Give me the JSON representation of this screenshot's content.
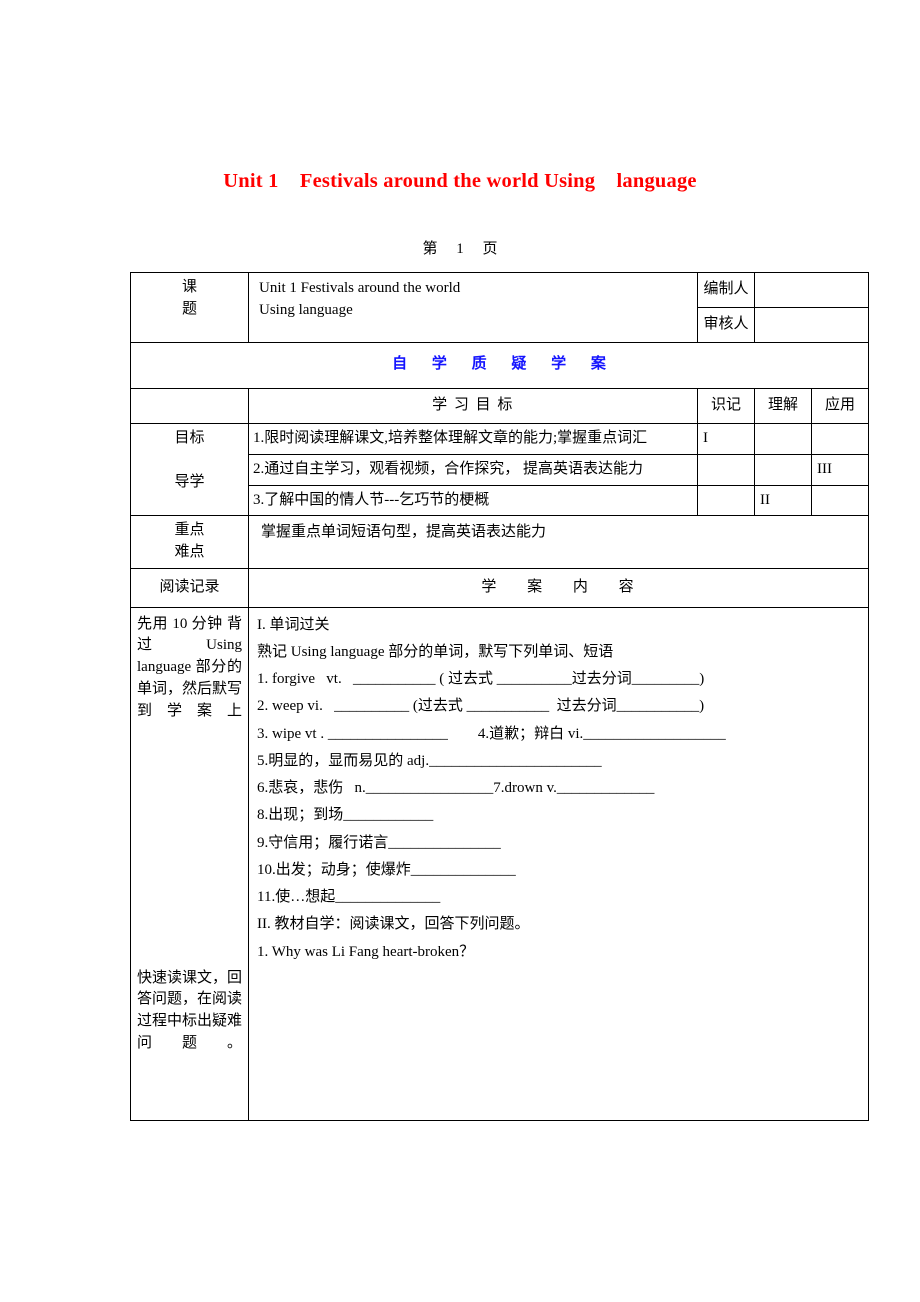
{
  "document": {
    "title": "Unit 1    Festivals around the world Using    language",
    "page_label": "第     1     页"
  },
  "info_table": {
    "topic_label": "课\n题",
    "topic_value": "Unit 1    Festivals around the world\n           Using    language",
    "compiler_label": "编制人",
    "compiler_value": "",
    "reviewer_label": "审核人",
    "reviewer_value": ""
  },
  "banner": "自     学     质     疑     学     案",
  "objectives_section": {
    "goals_header": "学 习 目 标",
    "level_headers": [
      "识记",
      "理解",
      "应用"
    ],
    "row_label": "目标\n\n导学",
    "rows": [
      {
        "text": "1.限时阅读理解课文,培养整体理解文章的能力;掌握重点词汇",
        "recognize": "I",
        "understand": "",
        "apply": ""
      },
      {
        "text": "2.通过自主学习，观看视频，合作探究，  提高英语表达能力",
        "recognize": "",
        "understand": "",
        "apply": "III"
      },
      {
        "text": "3.了解中国的情人节---乞巧节的梗概",
        "recognize": "",
        "understand": "II",
        "apply": ""
      }
    ]
  },
  "key_points": {
    "label": "重点\n难点",
    "text": "掌握重点单词短语句型，提高英语表达能力"
  },
  "content_section": {
    "reading_record_header": "阅读记录",
    "content_header": "学     案     内     容",
    "notes": [
      "先用 10 分钟 背过 Using language 部分的单词，然后默写到学案上",
      "快速读课文，回答问题，在阅读过程中标出疑难问题。"
    ],
    "part1_title": "I. 单词过关",
    "part1_instruction": "熟记 Using language 部分的单词，默写下列单词、短语",
    "vocab_lines": [
      "1. forgive   vt.   ___________ ( 过去式 __________过去分词_________)",
      "2. weep vi.   __________ (过去式 ___________  过去分词___________)",
      "3. wipe vt . ________________        4.道歉；辩白 vi.___________________",
      "5.明显的，显而易见的 adj._______________________",
      "6.悲哀，悲伤   n._________________7.drown v._____________",
      "8.出现；到场____________",
      "9.守信用；履行诺言_______________",
      "10.出发；动身；使爆炸______________",
      "11.使…想起______________"
    ],
    "part2_title": "II. 教材自学：阅读课文，回答下列问题。",
    "part2_questions": [
      "1. Why was Li Fang heart-broken？"
    ]
  },
  "colors": {
    "title_red": "#ff0000",
    "banner_blue": "#1414ff",
    "border": "#000000"
  }
}
